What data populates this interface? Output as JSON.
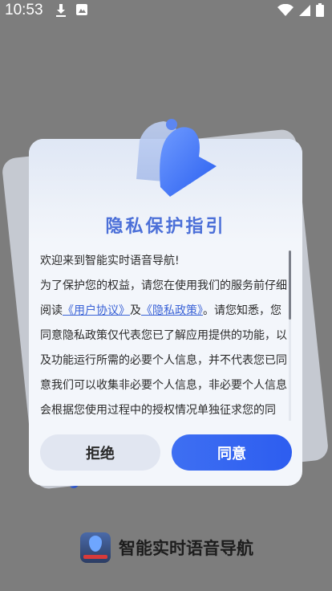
{
  "status_bar": {
    "time": "10:53",
    "left_icons": [
      "download-icon",
      "image-icon"
    ],
    "right_icons": [
      "wifi-icon",
      "signal-icon",
      "battery-icon"
    ]
  },
  "background": {
    "app_name": "智能实时语音导航"
  },
  "dialog": {
    "title": "隐私保护指引",
    "paragraph1": "欢迎来到智能实时语音导航!",
    "paragraph2_before": "为了保护您的权益，请您在使用我们的服务前仔细阅读",
    "link_user": "《用户协议》",
    "and_text": "及",
    "link_privacy": "《隐私政策》",
    "paragraph2_after": "。请您知悉，您同意隐私政策仅代表您已了解应用提供的功能，以及功能运行所需的必要个人信息，并不代表您已同意我们可以收集非必要个人信息，非必要个人信息会根据您使用过程中的授权情况单独征求您的同意。",
    "refuse_label": "拒绝",
    "agree_label": "同意"
  },
  "colors": {
    "accent": "#2d5df0",
    "title": "#4b6fd8",
    "overlay": "#7d7d7d"
  }
}
